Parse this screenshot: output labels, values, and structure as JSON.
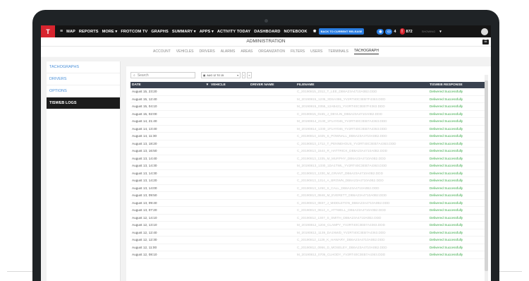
{
  "nav": {
    "logo": "T",
    "items": [
      "MAP",
      "REPORTS",
      "MORE ▾",
      "FROTCOM TV",
      "GRAPHS",
      "SUMMARY ▾",
      "APPS ▾",
      "ACTIVITY TODAY",
      "DASHBOARD",
      "NOTEBOOK"
    ],
    "back_button": "BACK TO CURRENT RELEASE",
    "messages_count": "4",
    "alerts_count": "872",
    "user": "SHOWING"
  },
  "admin": {
    "title": "ADMINISTRATION",
    "tabs": [
      "ACCOUNT",
      "VEHICLES",
      "DRIVERS",
      "ALARMS",
      "AREAS",
      "ORGANIZATION",
      "FILTERS",
      "USERS",
      "TERMINALS",
      "TACHOGRAPH"
    ],
    "active_tab": "TACHOGRAPH"
  },
  "sidebar": {
    "items": [
      "TACHOGRAPHS",
      "DRIVERS",
      "OPTIONS",
      "TISWEB LOGS"
    ],
    "active": "TISWEB LOGS"
  },
  "toolbar": {
    "search_placeholder": "Search",
    "date_range": "AUG 12 TO 15"
  },
  "table": {
    "columns": [
      "DATE",
      "VEHICLE",
      "DRIVER NAME",
      "FILENAME",
      "TISWEB RESPONSE"
    ],
    "rows": [
      {
        "date": "August 15, 23:20",
        "filename": "C_20190815_2312_T_LEE_DB6A23A4710A0B2.DDD",
        "response": "Delivered Successfully"
      },
      {
        "date": "August 15, 12:40",
        "filename": "M_20190815_1235_3DSA386_YV2RT40C3EB7F4363.DDD",
        "response": "Delivered Successfully"
      },
      {
        "date": "August 15, 04:10",
        "filename": "M_20190815_0355_12AB421_YV2RT40C3EB7F4363.DDD",
        "response": "Delivered Successfully"
      },
      {
        "date": "August 15, 02:00",
        "filename": "C_20190815_0155_J_DEVLIN_DB6A23A4710A0B2.DDD",
        "response": "Delivered Successfully"
      },
      {
        "date": "August 14, 21:40",
        "filename": "M_20190814_2130_1F1AY046_YV2RT40C3EB7A4363.DDD",
        "response": "Delivered Successfully"
      },
      {
        "date": "August 14, 13:40",
        "filename": "M_20190814_1330_1F1AY046_YV2RT40C3EB7A4363.DDD",
        "response": "Delivered Successfully"
      },
      {
        "date": "August 14, 11:30",
        "filename": "C_20190814_1025_S_POWNALL_DB6A23A4710A0B2.DDD",
        "response": "Delivered Successfully"
      },
      {
        "date": "August 13, 18:20",
        "filename": "C_20190813_1712_T_PENNEHOUS_YV2RT40C3EB7A4363.DDD",
        "response": "Delivered Successfully"
      },
      {
        "date": "August 13, 16:50",
        "filename": "C_20190813_1544_R_HATTRICK_DB6A23A4710A0B2.DDD",
        "response": "Delivered Successfully"
      },
      {
        "date": "August 13, 14:40",
        "filename": "C_20190813_1335_M_MURPHY_DB6A23A4710A0B2.DDD",
        "response": "Delivered Successfully"
      },
      {
        "date": "August 13, 14:30",
        "filename": "M_20190813_1330_1DA1TWL_YV2RT40C3EB7A4363.DDD",
        "response": "Delivered Successfully"
      },
      {
        "date": "August 13, 14:30",
        "filename": "C_20190813_1330_M_GRANT_DB6A23A4710A0B2.DDD",
        "response": "Delivered Successfully"
      },
      {
        "date": "August 13, 14:20",
        "filename": "C_20190813_1314_A_BROWN_DB6A23A4710A0B2.DDD",
        "response": "Delivered Successfully"
      },
      {
        "date": "August 13, 14:00",
        "filename": "C_20190813_1250_S_CALL_DB6A23A4710A0B2.DDD",
        "response": "Delivered Successfully"
      },
      {
        "date": "August 13, 09:50",
        "filename": "C_20190813_0848_M_EVERETT_DB6A23A4710A0B2.DDD",
        "response": "Delivered Successfully"
      },
      {
        "date": "August 13, 09:40",
        "filename": "C_20190813_0837_J_MIDDLETON_DB6A23A4710A0B2.DDD",
        "response": "Delivered Successfully"
      },
      {
        "date": "August 13, 07:20",
        "filename": "C_20190813_0614_A_ATTWELL_DB6A23A4710A0B2.DDD",
        "response": "Delivered Successfully"
      },
      {
        "date": "August 12, 14:10",
        "filename": "C_20190812_1307_S_SMITH_DB6A23A4710A0B2.DDD",
        "response": "Delivered Successfully"
      },
      {
        "date": "August 12, 13:10",
        "filename": "M_20190812_1204_CLAMPY_YV2RT40C3EB7A4363.DDD",
        "response": "Delivered Successfully"
      },
      {
        "date": "August 12, 12:40",
        "filename": "M_20190812_1139_DA1NWD_YV2RT40C3EB7A4363.DDD",
        "response": "Delivered Successfully"
      },
      {
        "date": "August 12, 12:30",
        "filename": "C_20190812_1129_K_HAWARY_DB6A23A4710A0B2.DDD",
        "response": "Delivered Successfully"
      },
      {
        "date": "August 12, 11:00",
        "filename": "C_20190812_0956_D_MOSELEY_DB6A23A4710A0B2.DDD",
        "response": "Delivered Successfully"
      },
      {
        "date": "August 12, 08:10",
        "filename": "M_20190812_0706_CLHODY_YV2RT40C3EB7A4363.DDD",
        "response": "Delivered Successfully"
      }
    ]
  },
  "colors": {
    "accent": "#2a7de1",
    "brand_red": "#d8252f",
    "success": "#3aa848",
    "header_bg": "#3a4250"
  }
}
